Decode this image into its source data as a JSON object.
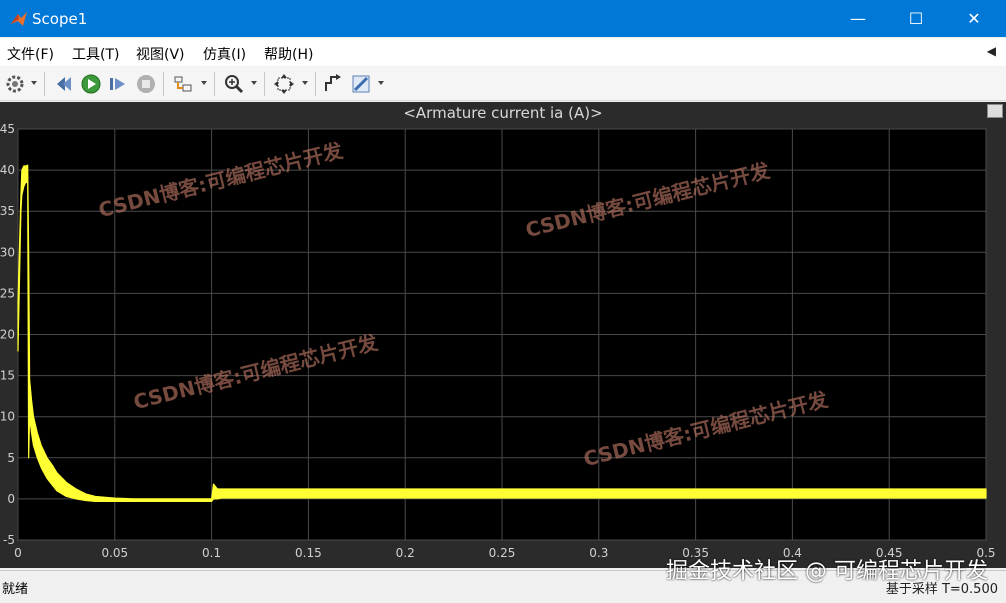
{
  "window": {
    "title": "Scope1",
    "min_glyph": "—",
    "max_glyph": "☐",
    "close_glyph": "✕"
  },
  "menu": {
    "items": [
      "文件(F)",
      "工具(T)",
      "视图(V)",
      "仿真(I)",
      "帮助(H)"
    ],
    "arrow": "◀"
  },
  "toolbar": {
    "icons": [
      "gear-icon",
      "restore-icon",
      "run-icon",
      "step-forward-icon",
      "stop-icon",
      "highlight-block-icon",
      "zoom-in-icon",
      "fit-to-view-icon",
      "style-icon",
      "measure-icon"
    ]
  },
  "chart_data": {
    "type": "line",
    "title": "<Armature current ia (A)>",
    "xlim": [
      0,
      0.5
    ],
    "ylim": [
      -5,
      45
    ],
    "xticks": [
      0,
      0.05,
      0.1,
      0.15,
      0.2,
      0.25,
      0.3,
      0.35,
      0.4,
      0.45,
      0.5
    ],
    "xtick_labels": [
      "0",
      "0.05",
      "0.1",
      "0.15",
      "0.2",
      "0.25",
      "0.3",
      "0.35",
      "0.4",
      "0.45",
      "0.5"
    ],
    "yticks": [
      -5,
      0,
      5,
      10,
      15,
      20,
      25,
      30,
      35,
      40,
      45
    ],
    "ytick_labels": [
      "-5",
      "0",
      "5",
      "10",
      "15",
      "20",
      "25",
      "30",
      "35",
      "40",
      "45"
    ],
    "grid": true,
    "series": [
      {
        "color": "#ffff33",
        "x": [
          0,
          0.0015,
          0.002,
          0.003,
          0.004,
          0.005,
          0.0055,
          0.006,
          0.007,
          0.008,
          0.01,
          0.012,
          0.015,
          0.018,
          0.02,
          0.025,
          0.03,
          0.035,
          0.04,
          0.05,
          0.06,
          0.08,
          0.1,
          0.101,
          0.102,
          0.103,
          0.105,
          0.11,
          0.15,
          0.2,
          0.25,
          0.3,
          0.35,
          0.4,
          0.45,
          0.5
        ],
        "y_upper": [
          24,
          37,
          40,
          40.5,
          40.5,
          40.6,
          30,
          14.5,
          12,
          10,
          8,
          6.5,
          5,
          4,
          3.2,
          2.0,
          1.2,
          0.6,
          0.3,
          0.1,
          0.0,
          0.0,
          0.0,
          1.8,
          1.5,
          1.2,
          1.2,
          1.2,
          1.2,
          1.2,
          1.2,
          1.2,
          1.2,
          1.2,
          1.2,
          1.2
        ],
        "y_lower": [
          18,
          35,
          37,
          38,
          38.5,
          38.5,
          5,
          10,
          8,
          6.5,
          5,
          3.8,
          2.5,
          1.6,
          1.0,
          0.3,
          0.0,
          -0.2,
          -0.3,
          -0.3,
          -0.3,
          -0.3,
          -0.3,
          0.0,
          0.0,
          0.0,
          0.1,
          0.1,
          0.1,
          0.1,
          0.1,
          0.1,
          0.1,
          0.1,
          0.1,
          0.1
        ]
      }
    ]
  },
  "watermarks": [
    "CSDN博客:可编程芯片开发",
    "CSDN博客:可编程芯片开发",
    "CSDN博客:可编程芯片开发",
    "CSDN博客:可编程芯片开发"
  ],
  "footer_watermark": "掘金技术社区 @ 可编程芯片开发",
  "status": {
    "left": "就绪",
    "right": "基于采样  T=0.500"
  }
}
